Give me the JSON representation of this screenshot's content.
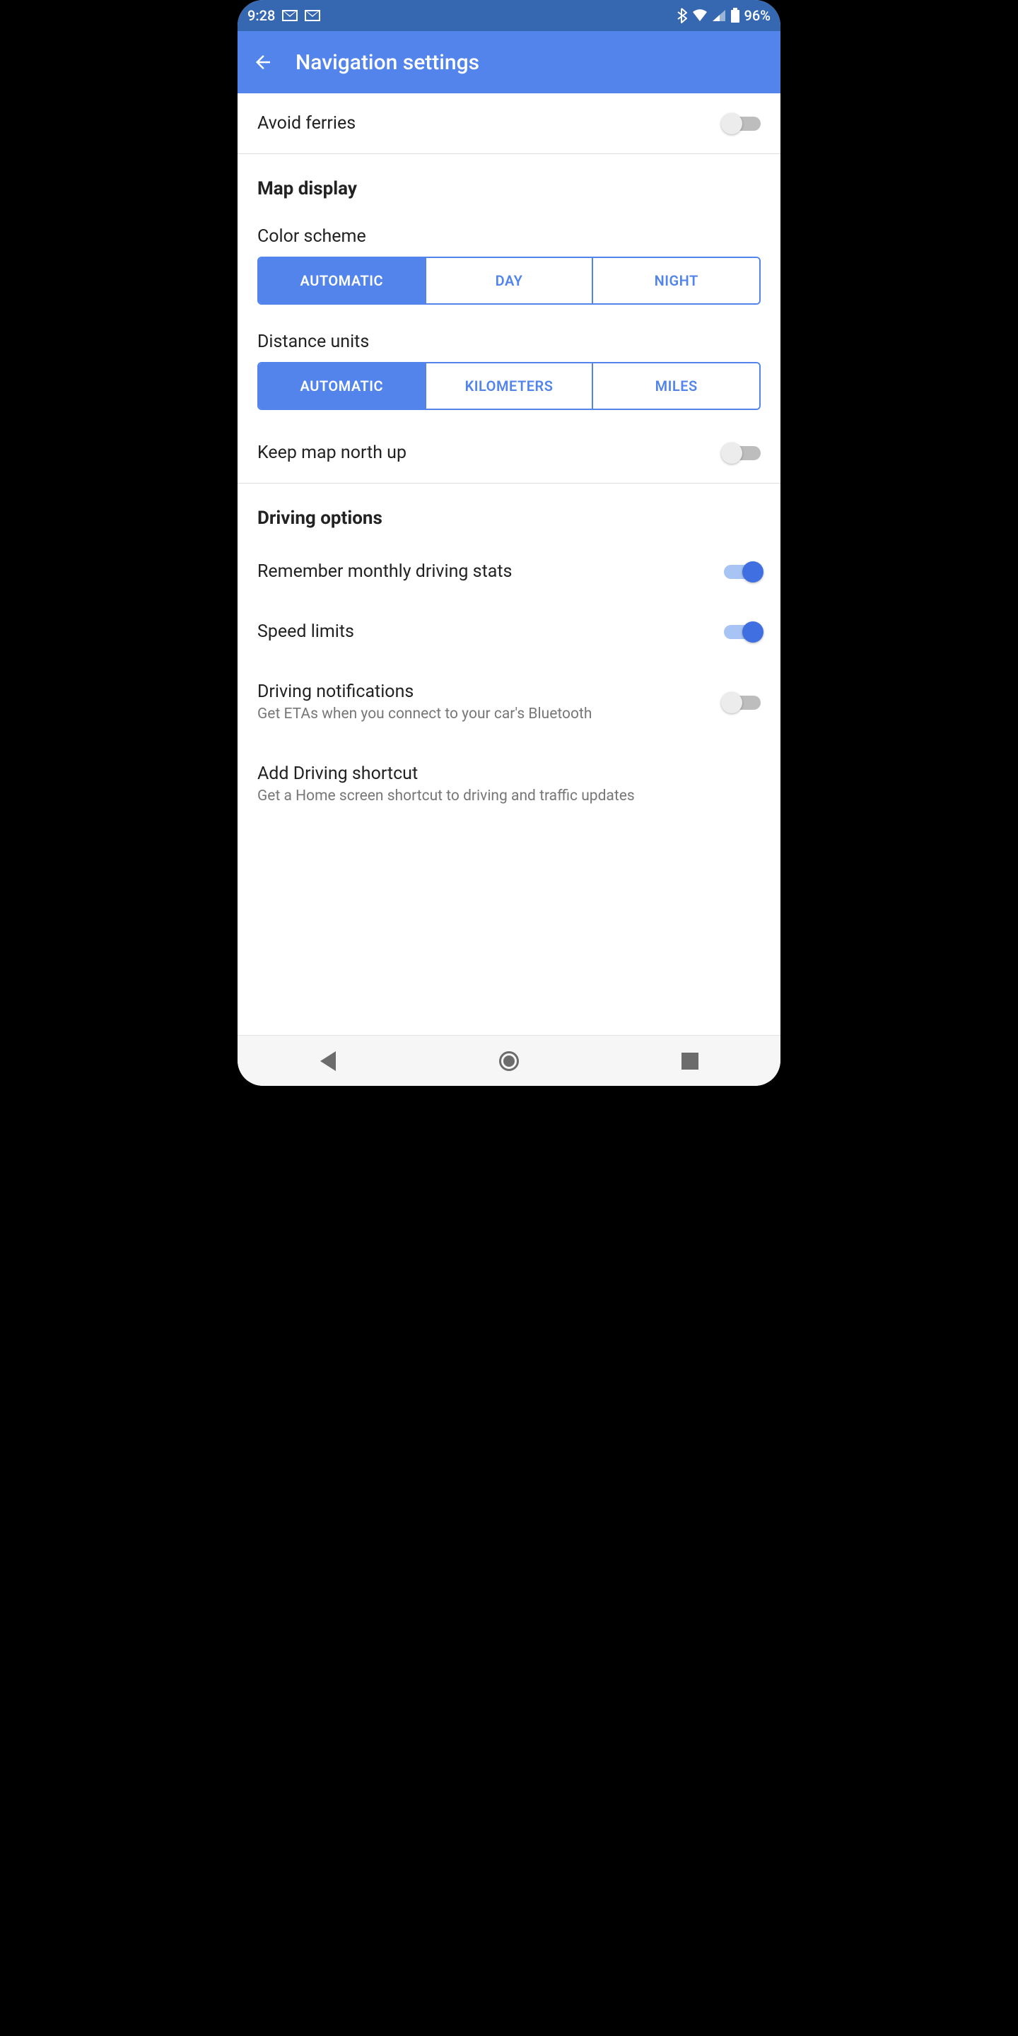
{
  "statusbar": {
    "time": "9:28",
    "battery": "96%"
  },
  "appbar": {
    "title": "Navigation settings"
  },
  "route": {
    "avoid_ferries": {
      "label": "Avoid ferries",
      "value": false
    }
  },
  "map_display": {
    "header": "Map display",
    "color_scheme": {
      "label": "Color scheme",
      "options": [
        "AUTOMATIC",
        "DAY",
        "NIGHT"
      ],
      "selected": 0
    },
    "distance_units": {
      "label": "Distance units",
      "options": [
        "AUTOMATIC",
        "KILOMETERS",
        "MILES"
      ],
      "selected": 0
    },
    "keep_north_up": {
      "label": "Keep map north up",
      "value": false
    }
  },
  "driving": {
    "header": "Driving options",
    "remember_stats": {
      "label": "Remember monthly driving stats",
      "value": true
    },
    "speed_limits": {
      "label": "Speed limits",
      "value": true
    },
    "notifications": {
      "label": "Driving notifications",
      "sub": "Get ETAs when you connect to your car's Bluetooth",
      "value": false
    },
    "shortcut": {
      "label": "Add Driving shortcut",
      "sub": "Get a Home screen shortcut to driving and traffic updates"
    }
  }
}
